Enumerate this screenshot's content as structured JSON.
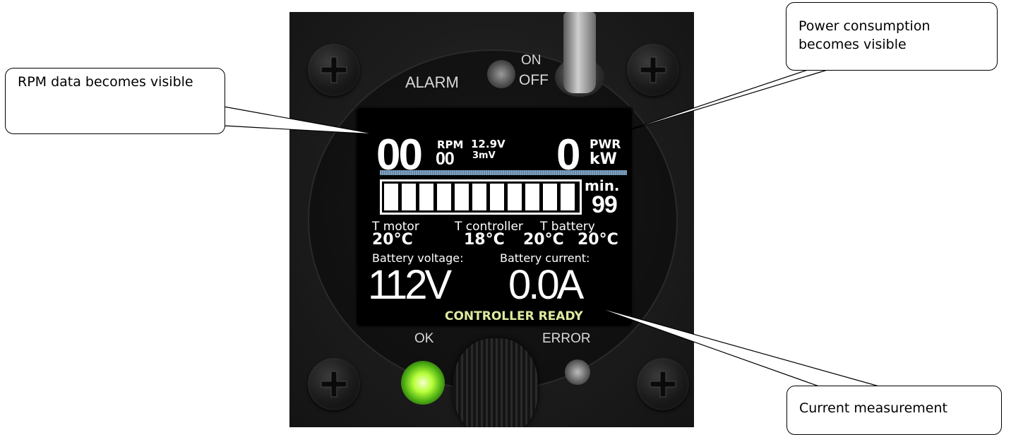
{
  "panel": {
    "alarm_label": "ALARM",
    "switch_on_label": "ON",
    "switch_off_label": "OFF",
    "ok_label": "OK",
    "error_label": "ERROR"
  },
  "display": {
    "rpm_big": "00",
    "rpm_label": "RPM",
    "rpm_small": "00",
    "voltage_small": "12.9V",
    "millivolt_small": "3mV",
    "power_value": "0",
    "power_label": "PWR",
    "power_unit": "kW",
    "battery_cells_lit": 11,
    "minutes_label": "min.",
    "minutes_value": "99",
    "temp_labels": [
      "T motor",
      "T controller",
      "T battery"
    ],
    "temp_values": [
      "20°C",
      "18°C",
      "20°C",
      "20°C"
    ],
    "battery_voltage_label": "Battery voltage:",
    "battery_current_label": "Battery current:",
    "battery_voltage_value": "112V",
    "battery_current_value": "0.0A",
    "status_text": "CONTROLLER READY"
  },
  "callouts": {
    "rpm": "RPM data becomes visible",
    "power": "Power consumption becomes visible",
    "current": "Current measurement"
  }
}
